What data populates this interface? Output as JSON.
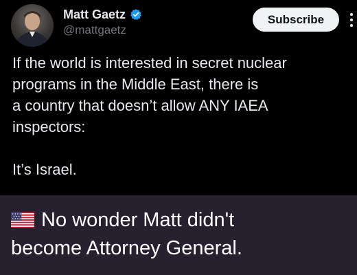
{
  "post": {
    "author": {
      "display_name": "Matt Gaetz",
      "handle": "@mattgaetz",
      "verified": true,
      "avatar_icon": "profile-photo"
    },
    "subscribe_label": "Subscribe",
    "more_icon": "more-vertical-icon",
    "text_lines": [
      "If the world is interested in secret nuclear",
      "programs in the Middle East, there is",
      "a country that doesn’t allow ANY IAEA",
      "inspectors:"
    ],
    "closing_line": "It’s Israel."
  },
  "caption": {
    "flag_icon": "us-flag-emoji",
    "line1": "No wonder Matt didn't",
    "line2": "become Attorney General."
  },
  "colors": {
    "post_background": "#000000",
    "caption_background": "#27212f",
    "verified_blue": "#1d9bf0",
    "handle_gray": "#71767b",
    "subscribe_background": "#eff3f4"
  }
}
